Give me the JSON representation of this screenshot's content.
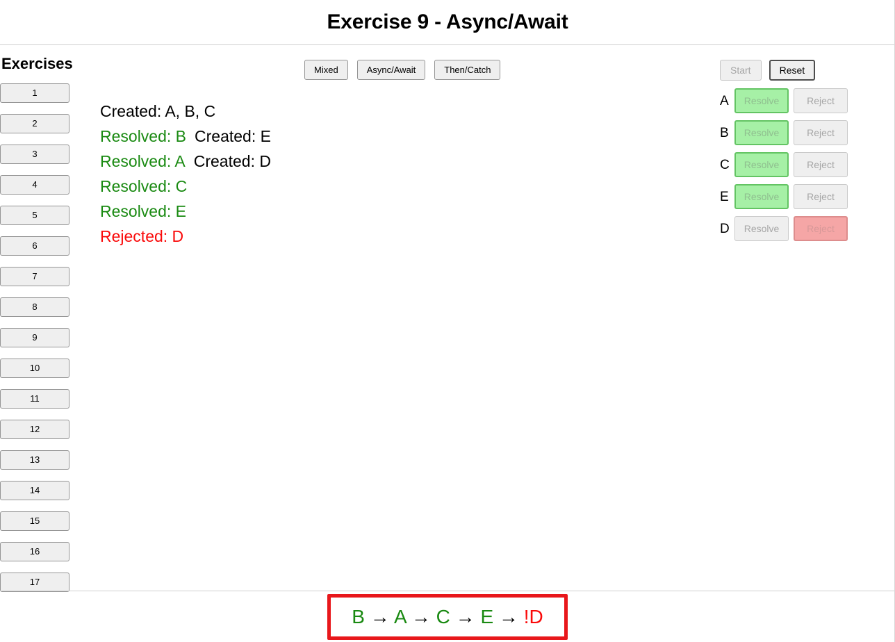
{
  "header": {
    "title": "Exercise 9 - Async/Await"
  },
  "sidebar": {
    "heading": "Exercises",
    "items": [
      {
        "label": "1"
      },
      {
        "label": "2"
      },
      {
        "label": "3"
      },
      {
        "label": "4"
      },
      {
        "label": "5"
      },
      {
        "label": "6"
      },
      {
        "label": "7"
      },
      {
        "label": "8"
      },
      {
        "label": "9"
      },
      {
        "label": "10"
      },
      {
        "label": "11"
      },
      {
        "label": "12"
      },
      {
        "label": "13"
      },
      {
        "label": "14"
      },
      {
        "label": "15"
      },
      {
        "label": "16"
      },
      {
        "label": "17"
      }
    ]
  },
  "modes": {
    "buttons": [
      {
        "label": "Mixed"
      },
      {
        "label": "Async/Await"
      },
      {
        "label": "Then/Catch"
      }
    ]
  },
  "run_controls": {
    "start_label": "Start",
    "start_disabled": true,
    "reset_label": "Reset",
    "reset_disabled": false
  },
  "promises": {
    "resolve_label": "Resolve",
    "reject_label": "Reject",
    "rows": [
      {
        "name": "A",
        "state": "resolved"
      },
      {
        "name": "B",
        "state": "resolved"
      },
      {
        "name": "C",
        "state": "resolved"
      },
      {
        "name": "E",
        "state": "resolved"
      },
      {
        "name": "D",
        "state": "rejected"
      }
    ]
  },
  "log": {
    "lines": [
      [
        {
          "text": "Created: A, B, C",
          "kind": "created"
        }
      ],
      [
        {
          "text": "Resolved: B",
          "kind": "resolved"
        },
        {
          "text": "Created: E",
          "kind": "created"
        }
      ],
      [
        {
          "text": "Resolved: A",
          "kind": "resolved"
        },
        {
          "text": "Created: D",
          "kind": "created"
        }
      ],
      [
        {
          "text": "Resolved: C",
          "kind": "resolved"
        }
      ],
      [
        {
          "text": "Resolved: E",
          "kind": "resolved"
        }
      ],
      [
        {
          "text": "Rejected: D",
          "kind": "rejected"
        }
      ]
    ]
  },
  "result": {
    "tokens": [
      {
        "text": "B",
        "kind": "ok"
      },
      {
        "text": " → ",
        "kind": "arrow"
      },
      {
        "text": "A",
        "kind": "ok"
      },
      {
        "text": " → ",
        "kind": "arrow"
      },
      {
        "text": "C",
        "kind": "ok"
      },
      {
        "text": " → ",
        "kind": "arrow"
      },
      {
        "text": "E",
        "kind": "ok"
      },
      {
        "text": " → ",
        "kind": "arrow"
      },
      {
        "text": "!D",
        "kind": "fail"
      }
    ],
    "border_color": "#e8171b"
  },
  "colors": {
    "resolved_green": "#1a8a12",
    "rejected_red": "#fa0a0a",
    "resolve_btn_bg": "#a6f0a6",
    "reject_btn_bg": "#f5a6a6"
  }
}
